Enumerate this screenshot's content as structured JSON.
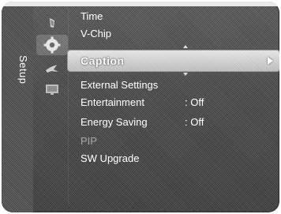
{
  "sidebar": {
    "label": "Setup",
    "icons": [
      "picture-icon",
      "setup-icon",
      "sound-icon",
      "input-icon"
    ]
  },
  "menu": {
    "items": [
      {
        "label": "Time",
        "value": "",
        "state": "normal"
      },
      {
        "label": "V-Chip",
        "value": "",
        "state": "normal"
      },
      {
        "label": "Caption",
        "value": "",
        "state": "selected"
      },
      {
        "label": "External Settings",
        "value": "",
        "state": "normal"
      },
      {
        "label": "Entertainment",
        "value": ": Off",
        "state": "normal"
      },
      {
        "label": "Energy Saving",
        "value": ": Off",
        "state": "normal"
      },
      {
        "label": "PIP",
        "value": "",
        "state": "disabled"
      },
      {
        "label": "SW Upgrade",
        "value": "",
        "state": "normal"
      }
    ]
  },
  "colors": {
    "background": "#4a4a4a",
    "highlight": "#d6d6d6",
    "text": "#ffffff",
    "disabled_text": "#a8a8a8"
  }
}
